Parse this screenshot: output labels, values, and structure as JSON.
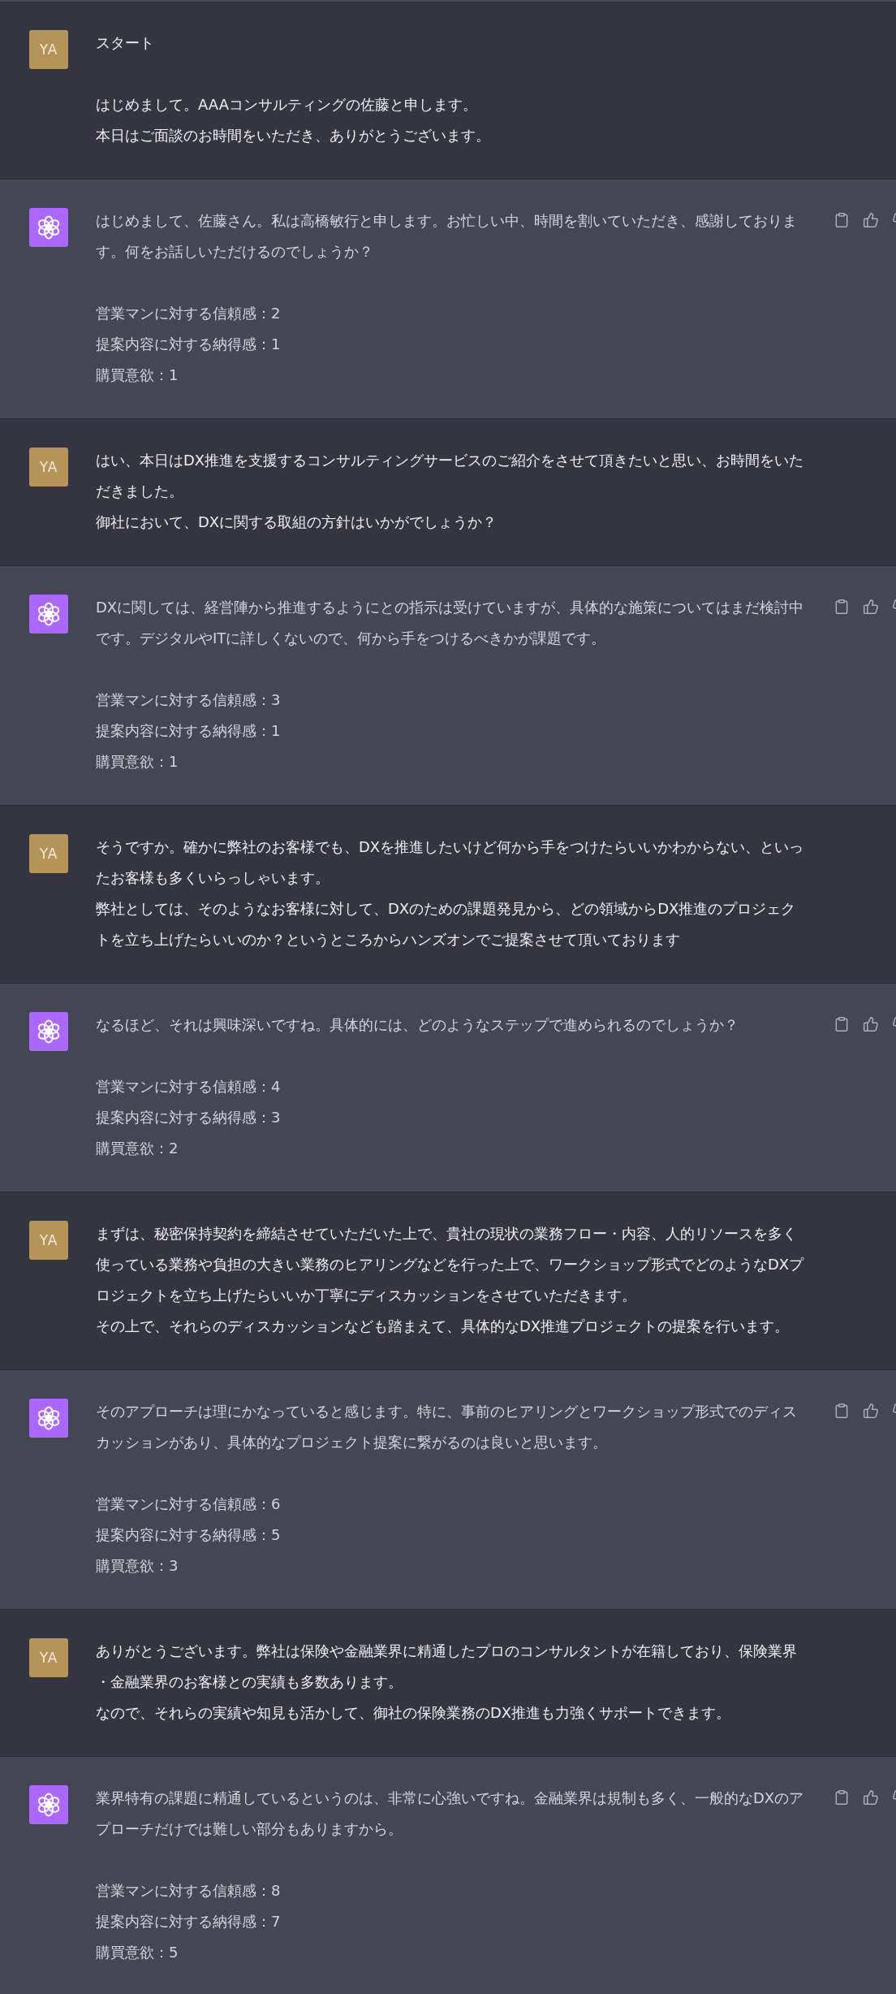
{
  "messages": [
    {
      "kind": "user",
      "avatar": "YA",
      "paragraphs": [
        [
          "スタート"
        ],
        [
          "はじめまして。AAAコンサルティングの佐藤と申します。",
          "本日はご面談のお時間をいただき、ありがとうございます。"
        ]
      ]
    },
    {
      "kind": "assistant",
      "paragraphs": [
        [
          "はじめまして、佐藤さん。私は高橋敏行と申します。お忙しい中、時間を割いていただき、感謝しております。何をお話しいただけるのでしょうか？"
        ]
      ],
      "ratings": [
        "営業マンに対する信頼感：2",
        "提案内容に対する納得感：1",
        "購買意欲：1"
      ]
    },
    {
      "kind": "user",
      "avatar": "YA",
      "paragraphs": [
        [
          "はい、本日はDX推進を支援するコンサルティングサービスのご紹介をさせて頂きたいと思い、お時間をいただきました。",
          "御社において、DXに関する取組の方針はいかがでしょうか？"
        ]
      ]
    },
    {
      "kind": "assistant",
      "paragraphs": [
        [
          "DXに関しては、経営陣から推進するようにとの指示は受けていますが、具体的な施策についてはまだ検討中です。デジタルやITに詳しくないので、何から手をつけるべきかが課題です。"
        ]
      ],
      "ratings": [
        "営業マンに対する信頼感：3",
        "提案内容に対する納得感：1",
        "購買意欲：1"
      ]
    },
    {
      "kind": "user",
      "avatar": "YA",
      "paragraphs": [
        [
          "そうですか。確かに弊社のお客様でも、DXを推進したいけど何から手をつけたらいいかわからない、といったお客様も多くいらっしゃいます。",
          "弊社としては、そのようなお客様に対して、DXのための課題発見から、どの領域からDX推進のプロジェクトを立ち上げたらいいのか？というところからハンズオンでご提案させて頂いております"
        ]
      ]
    },
    {
      "kind": "assistant",
      "paragraphs": [
        [
          "なるほど、それは興味深いですね。具体的には、どのようなステップで進められるのでしょうか？"
        ]
      ],
      "ratings": [
        "営業マンに対する信頼感：4",
        "提案内容に対する納得感：3",
        "購買意欲：2"
      ]
    },
    {
      "kind": "user",
      "avatar": "YA",
      "paragraphs": [
        [
          "まずは、秘密保持契約を締結させていただいた上で、貴社の現状の業務フロー・内容、人的リソースを多く使っている業務や負担の大きい業務のヒアリングなどを行った上で、ワークショップ形式でどのようなDXプロジェクトを立ち上げたらいいか丁寧にディスカッションをさせていただきます。",
          "その上で、それらのディスカッションなども踏まえて、具体的なDX推進プロジェクトの提案を行います。"
        ]
      ]
    },
    {
      "kind": "assistant",
      "paragraphs": [
        [
          "そのアプローチは理にかなっていると感じます。特に、事前のヒアリングとワークショップ形式でのディスカッションがあり、具体的なプロジェクト提案に繋がるのは良いと思います。"
        ]
      ],
      "ratings": [
        "営業マンに対する信頼感：6",
        "提案内容に対する納得感：5",
        "購買意欲：3"
      ]
    },
    {
      "kind": "user",
      "avatar": "YA",
      "paragraphs": [
        [
          "ありがとうございます。弊社は保険や金融業界に精通したプロのコンサルタントが在籍しており、保険業界・金融業界のお客様との実績も多数あります。",
          "なので、それらの実績や知見も活かして、御社の保険業務のDX推進も力強くサポートできます。"
        ]
      ]
    },
    {
      "kind": "assistant",
      "paragraphs": [
        [
          "業界特有の課題に精通しているというのは、非常に心強いですね。金融業界は規制も多く、一般的なDXのアプローチだけでは難しい部分もありますから。"
        ]
      ],
      "ratings": [
        "営業マンに対する信頼感：8",
        "提案内容に対する納得感：7",
        "購買意欲：5"
      ]
    }
  ]
}
